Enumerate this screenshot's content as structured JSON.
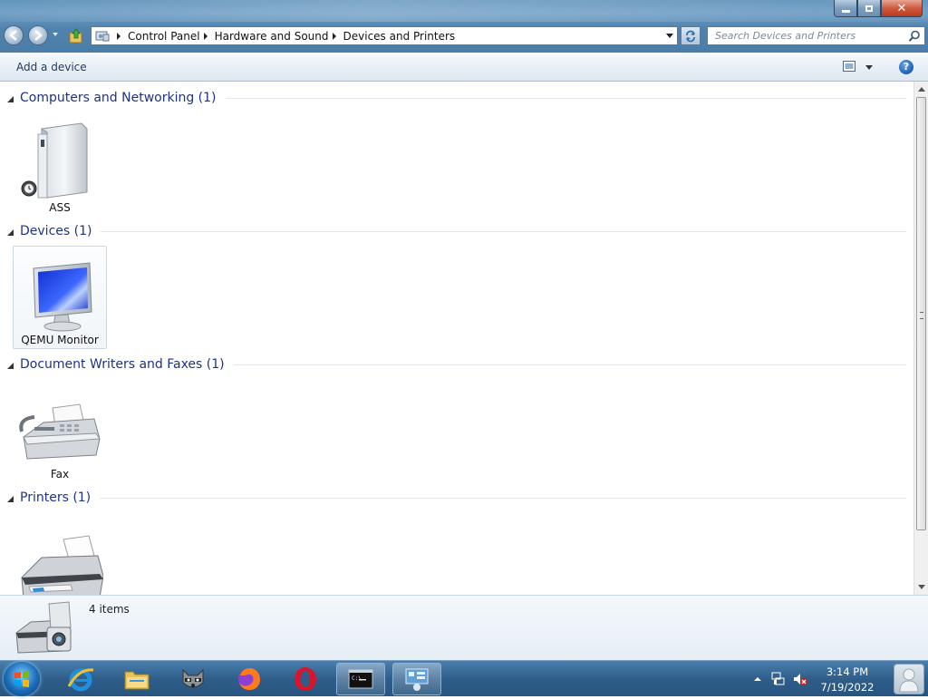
{
  "window": {
    "window_buttons": {
      "minimize_icon": "minimize-icon",
      "maximize_icon": "restore-icon",
      "close_icon": "close-icon"
    }
  },
  "address_bar": {
    "breadcrumbs": [
      "Control Panel",
      "Hardware and Sound",
      "Devices and Printers"
    ]
  },
  "search": {
    "placeholder": "Search Devices and Printers"
  },
  "toolbar": {
    "add_device_label": "Add a device",
    "help_label": "?"
  },
  "groups": [
    {
      "title": "Computers and Networking (1)",
      "items": [
        {
          "label": "ASS",
          "icon": "computer-icon"
        }
      ]
    },
    {
      "title": "Devices (1)",
      "items": [
        {
          "label": "QEMU Monitor",
          "icon": "monitor-icon"
        }
      ]
    },
    {
      "title": "Document Writers and Faxes (1)",
      "items": [
        {
          "label": "Fax",
          "icon": "fax-icon"
        }
      ]
    },
    {
      "title": "Printers (1)",
      "items": [
        {
          "label": "",
          "icon": "printer-icon"
        }
      ]
    }
  ],
  "details": {
    "item_count": "4 items"
  },
  "taskbar": {
    "pinned": [
      "start-orb",
      "internet-explorer-icon",
      "file-explorer-icon",
      "raccoon-app-icon",
      "firefox-icon",
      "opera-icon",
      "command-prompt-icon",
      "devices-and-printers-icon"
    ],
    "clock_time": "3:14 PM",
    "clock_date": "7/19/2022"
  },
  "colors": {
    "group_title": "#1e3287",
    "title_bar": "#4f82ad",
    "taskbar": "#2f5e8b"
  }
}
